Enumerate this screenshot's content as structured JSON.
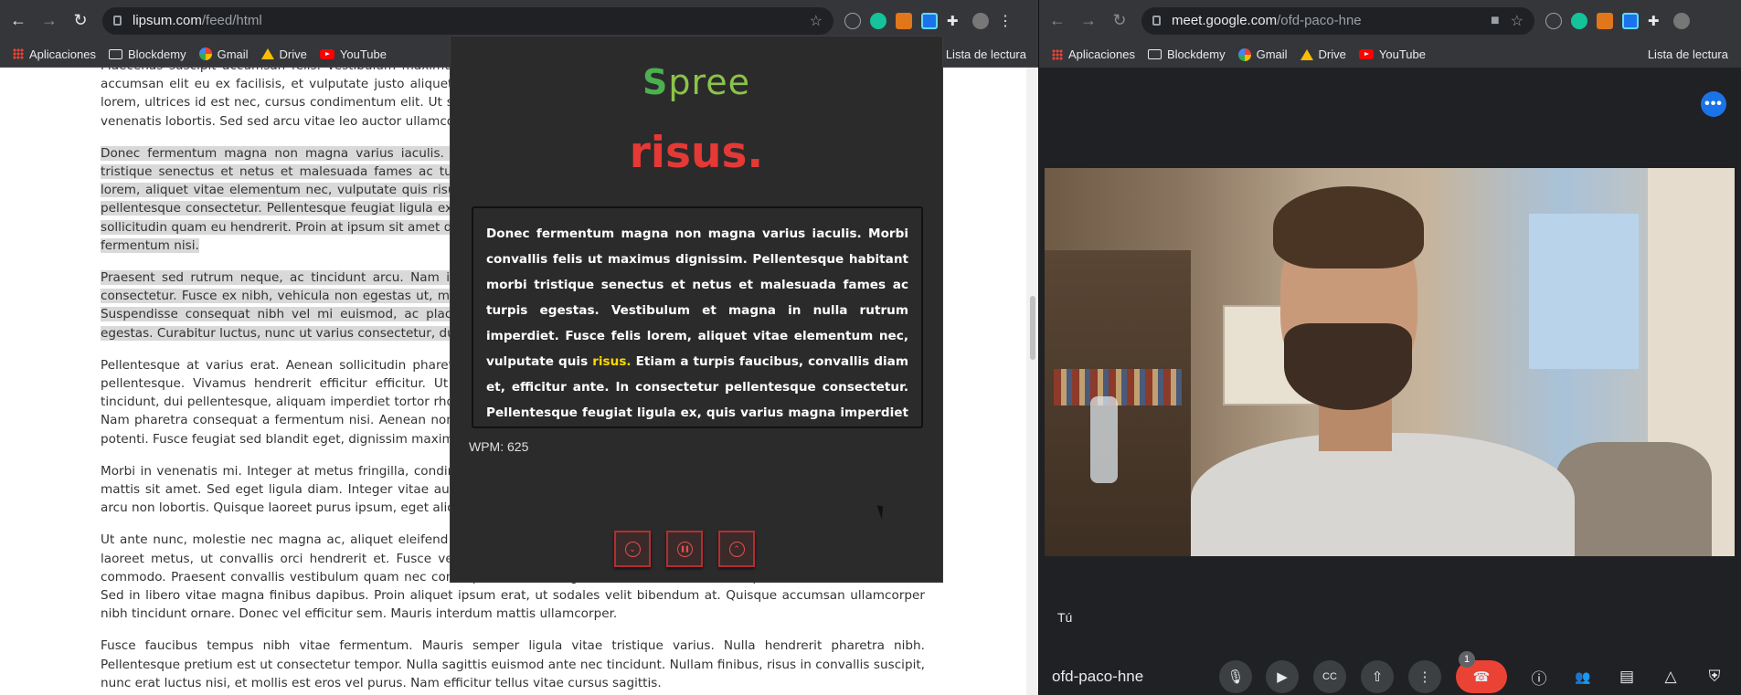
{
  "left_browser": {
    "url_host": "lipsum.com",
    "url_path": "/feed/html",
    "bookmarks": [
      {
        "label": "Aplicaciones",
        "icon": "apps-grid-icon"
      },
      {
        "label": "Blockdemy",
        "icon": "folder-icon"
      },
      {
        "label": "Gmail",
        "icon": "google-icon"
      },
      {
        "label": "Drive",
        "icon": "drive-icon"
      },
      {
        "label": "YouTube",
        "icon": "youtube-icon"
      }
    ],
    "reading_list": "Lista de lectura"
  },
  "article": {
    "paragraphs": [
      {
        "text": "Maecenas suscipit accumsan felis. Vestibulum maximus ultricies urna at sodales. Proin tempor urna eget velit scelerisque, quis accumsan elit eu ex facilisis, et vulputate justo aliquet. Quisque at tincidunt lorem. Vivamus interdum porttitor risus, et suscipit lorem, ultrices id est nec, cursus condimentum elit. Ut sit amet dapibus erat, eget pharetra tellus. Proin in lectus dolor. Sed aliquet venenatis lobortis. Sed sed arcu vitae leo auctor ullamcorper eget eu turpis. Sed venenatis risus sed porta vehicula. Nulla facilisi.",
        "highlighted": false
      },
      {
        "text": "Donec fermentum magna non magna varius iaculis. Morbi convallis felis ut maximus dignissim. Pellentesque habitant morbi tristique senectus et netus et malesuada fames ac turpis egestas. Vestibulum et magna in nulla rutrum imperdiet. Fusce felis lorem, aliquet vitae elementum nec, vulputate quis risus. Etiam a turpis faucibus, convallis diam et, efficitur ante. In consectetur pellentesque consectetur. Pellentesque feugiat ligula ex, quis varius magna imperdiet vitae. Ut auctor gravida lorem. Nulla laoreet sollicitudin quam eu hendrerit. Proin at ipsum sit amet dui tincidunt laoreet. Nam vehicula dolor pharetra ante lectus at orci. Nam in fermentum nisi.",
        "highlighted": true
      },
      {
        "text": "Praesent sed rutrum neque, ac tincidunt arcu. Nam imperdiet sapien in lectus accumsan, et facilisis ex porta. In consectetur consectetur. Fusce ex nibh, vehicula non egestas ut, malesuada id erat. Sed placerat, mi at condimentum malesuada, velit libero. Suspendisse consequat nibh vel mi euismod, ac placerat lacus dictum. Aliquam convallis arcu non lacus volutpat, ut lacinia egestas. Curabitur luctus, nunc ut varius consectetur, dui ut dignissim nunc.",
        "highlighted": true
      },
      {
        "text": "Pellentesque at varius erat. Aenean sollicitudin pharetra turpis. In hac habitasse platea dictumst. Nullam commodo mauris ac pellentesque. Vivamus hendrerit efficitur efficitur. Ut hendrerit nec lectus nec tincidunt. Morbi laoreet, ligula at fermentum tincidunt, dui pellentesque, aliquam imperdiet tortor rhoncus. Nullam dignissim urna non augue feugiat, ut tincidunt est accumsan. Nam pharetra consequat a fermentum nisi. Aenean non vehicula lectus. Sed non turpis eget neque sodales placerat. Suspendisse potenti. Fusce feugiat sed blandit eget, dignissim maximus eros. Morbi mollis sem ac porttitor vehicula.",
        "highlighted": false
      },
      {
        "text": "Morbi in venenatis mi. Integer at metus fringilla, condimentum lorem vitae, consequat lorem. Suspendisse potenti. Nunc faucibus mattis sit amet. Sed eget ligula diam. Integer vitae augue a eros placerat volutpat. Vivamus tristique, lorem at fringilla volutpat, arcu non lobortis. Quisque laoreet purus ipsum, eget aliquam mauris pretium sed.",
        "highlighted": false
      },
      {
        "text": "Ut ante nunc, molestie nec magna ac, aliquet eleifend orci. Donec aliquet augue in ante iaculis, a ultrices sem aliquam. Aliquam laoreet metus, ut convallis orci hendrerit et. Fusce vel mauris at nibh facilisis hendrerit vitae eu ligula. Etiam sit amet ipsum commodo. Praesent convallis vestibulum quam nec consequat. Donec fringilla condimentum tellus, et pulvinar sem vestibulum a. Sed in libero vitae magna finibus dapibus. Proin aliquet ipsum erat, ut sodales velit bibendum at. Quisque accumsan ullamcorper nibh tincidunt ornare. Donec vel efficitur sem. Mauris interdum mattis ullamcorper.",
        "highlighted": false
      },
      {
        "text": "Fusce faucibus tempus nibh vitae fermentum. Mauris semper ligula vitae tristique varius. Nulla hendrerit pharetra nibh. Pellentesque pretium est ut consectetur tempor. Nulla sagittis euismod ante nec tincidunt. Nullam finibus, risus in convallis suscipit, nunc erat luctus nisi, et mollis est eros vel purus. Nam efficitur tellus vitae cursus sagittis.",
        "highlighted": false
      }
    ]
  },
  "spree": {
    "logo": "Spree",
    "current_word": "risus.",
    "reader_before": "Donec fermentum magna non magna varius iaculis. Morbi convallis felis ut maximus dignissim. Pellentesque habitant morbi tristique senectus et netus et malesuada fames ac turpis egestas. Vestibulum et magna in nulla rutrum imperdiet. Fusce felis lorem, aliquet vitae elementum nec, vulputate quis ",
    "reader_highlight": "risus.",
    "reader_after": " Etiam a turpis faucibus, convallis diam et, efficitur ante. In consectetur pellentesque consectetur. Pellentesque feugiat ligula ex, quis varius magna imperdiet vitae. Ut auctor gravida",
    "wpm_label": "WPM: 625",
    "buttons": [
      {
        "name": "speed-down-button",
        "icon": "chevron-down-icon",
        "glyph": "⌄"
      },
      {
        "name": "pause-button",
        "icon": "pause-icon",
        "glyph": "❚❚"
      },
      {
        "name": "speed-up-button",
        "icon": "chevron-up-icon",
        "glyph": "⌃"
      }
    ],
    "colors": {
      "current_word": "#e53935",
      "highlight": "#ffd600",
      "logo": "#8bc34a"
    }
  },
  "right_browser": {
    "url_host": "meet.google.com",
    "url_path": "/ofd-paco-hne",
    "bookmarks": [
      {
        "label": "Aplicaciones",
        "icon": "apps-grid-icon"
      },
      {
        "label": "Blockdemy",
        "icon": "folder-icon"
      },
      {
        "label": "Gmail",
        "icon": "google-icon"
      },
      {
        "label": "Drive",
        "icon": "drive-icon"
      },
      {
        "label": "YouTube",
        "icon": "youtube-icon"
      }
    ],
    "reading_list": "Lista de lectura"
  },
  "meet": {
    "self_label": "Tú",
    "meeting_code": "ofd-paco-hne",
    "participants_count": "1",
    "more_options_glyph": "•••",
    "controls": [
      {
        "name": "mic-button",
        "icon": "microphone-icon",
        "glyph": "🎙"
      },
      {
        "name": "camera-button",
        "icon": "camera-icon",
        "glyph": "▶"
      },
      {
        "name": "captions-button",
        "icon": "captions-icon",
        "glyph": "CC"
      },
      {
        "name": "present-button",
        "icon": "present-screen-icon",
        "glyph": "⇧"
      },
      {
        "name": "more-options-button",
        "icon": "more-vert-icon",
        "glyph": "⋮"
      },
      {
        "name": "end-call-button",
        "icon": "end-call-icon",
        "glyph": "☎"
      }
    ],
    "side_controls": [
      {
        "name": "meeting-details-button",
        "icon": "info-icon",
        "glyph": "ⓘ"
      },
      {
        "name": "people-button",
        "icon": "people-icon",
        "glyph": "👥"
      },
      {
        "name": "chat-button",
        "icon": "chat-icon",
        "glyph": "▤"
      },
      {
        "name": "activities-button",
        "icon": "activities-icon",
        "glyph": "△"
      },
      {
        "name": "host-controls-button",
        "icon": "shield-icon",
        "glyph": "⛨"
      }
    ]
  }
}
